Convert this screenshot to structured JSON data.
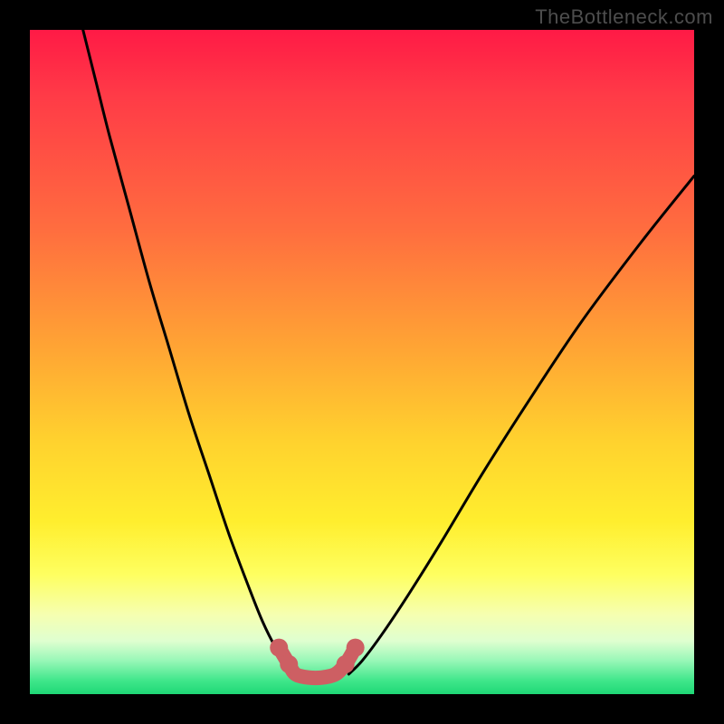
{
  "watermark": "TheBottleneck.com",
  "chart_data": {
    "type": "line",
    "title": "",
    "xlabel": "",
    "ylabel": "",
    "xlim": [
      0,
      100
    ],
    "ylim": [
      0,
      100
    ],
    "grid": false,
    "legend": false,
    "note": "Two black curves descending from top into a red trough region near the bottom, over a red→green vertical gradient. No numeric axes shown; x/y are normalized 0–100.",
    "series": [
      {
        "name": "left-curve",
        "color": "#000000",
        "x": [
          8,
          10,
          12,
          15,
          18,
          21,
          24,
          27,
          30,
          33,
          35,
          37,
          39,
          40
        ],
        "y": [
          100,
          92,
          84,
          73,
          62,
          52,
          42,
          33,
          24,
          16,
          11,
          7,
          4,
          3
        ]
      },
      {
        "name": "right-curve",
        "color": "#000000",
        "x": [
          48,
          50,
          53,
          57,
          62,
          68,
          75,
          83,
          92,
          100
        ],
        "y": [
          3,
          5,
          9,
          15,
          23,
          33,
          44,
          56,
          68,
          78
        ]
      },
      {
        "name": "trough-marker",
        "color": "#cd5f63",
        "style": "thick-dots",
        "x": [
          37.5,
          39,
          40,
          42,
          44,
          46,
          47.5,
          49
        ],
        "y": [
          7,
          4.5,
          3,
          2.5,
          2.5,
          3,
          4.5,
          7
        ]
      }
    ]
  }
}
